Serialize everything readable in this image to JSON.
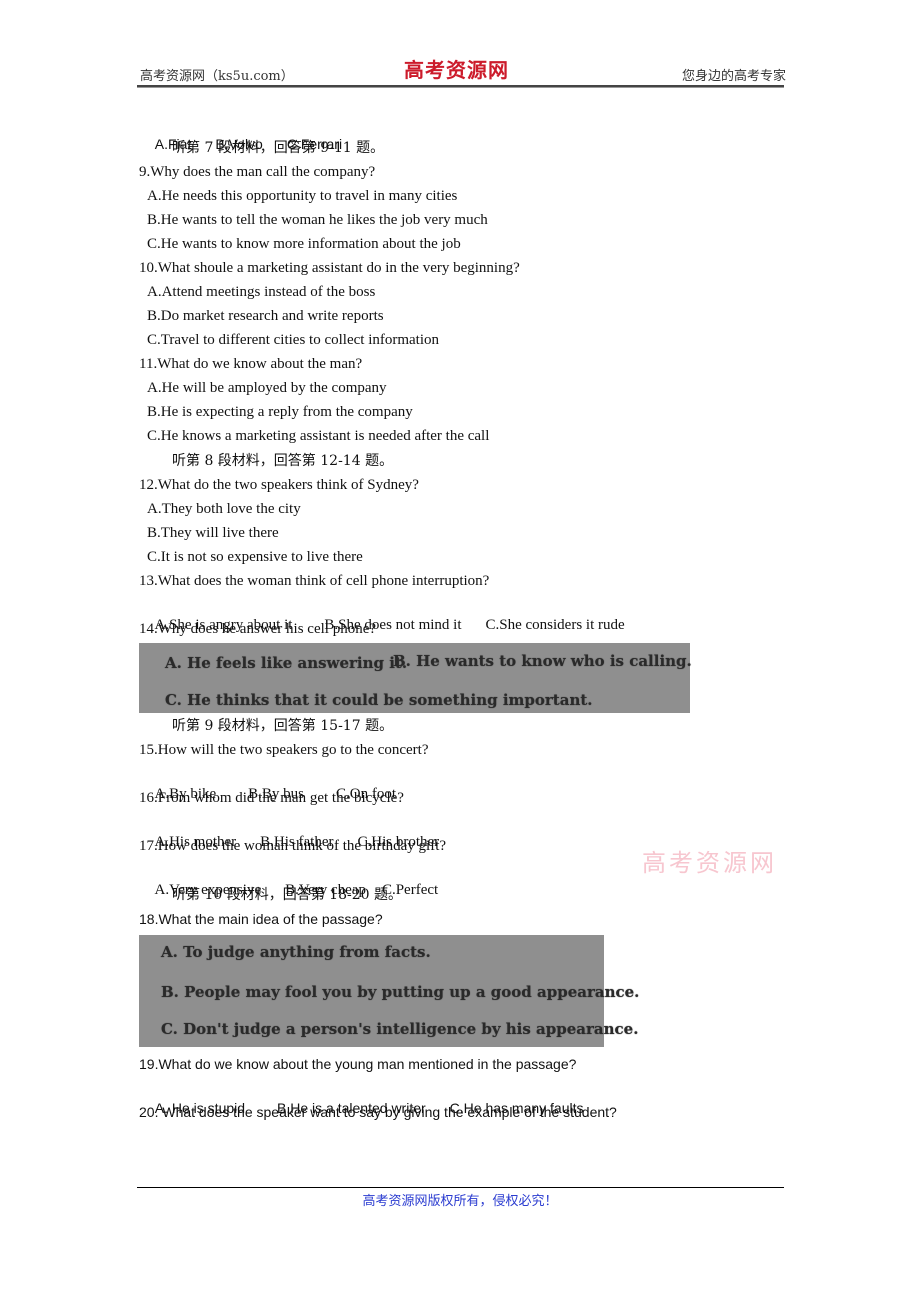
{
  "header": {
    "left": "高考资源网（ks5u.com）",
    "center_logo": "高考资源网",
    "right": "您身边的高考专家"
  },
  "q8_options": [
    "A.Fiat",
    "B.Volvo",
    "C.Ferrari"
  ],
  "section7": "听第 7 段材料，回答第 9-11 题。",
  "q9": {
    "question": "9.Why does the man call the company?",
    "options": [
      "A.He needs this opportunity to travel in many cities",
      "B.He wants to tell the woman he likes the job very much",
      "C.He wants to know more information about the job"
    ]
  },
  "q10": {
    "question": "10.What shoule a marketing assistant do in the very beginning?",
    "options": [
      "A.Attend meetings instead of the boss",
      "B.Do market research and write reports",
      "C.Travel to different cities to collect information"
    ]
  },
  "q11": {
    "question": "11.What do we know about the man?",
    "options": [
      "A.He will be amployed by the company",
      "B.He is expecting a reply from the company",
      "C.He knows a marketing assistant is needed after the call"
    ]
  },
  "section8": "听第 8 段材料，回答第 12-14 题。",
  "q12": {
    "question": "12.What do the two speakers think of Sydney?",
    "options": [
      "A.They both love the city",
      "B.They will live there",
      "C.It is not so expensive to live there"
    ]
  },
  "q13": {
    "question": "13.What does the woman think of cell phone interruption?",
    "options": [
      "A.She is angry about it",
      "B.She does not mind it",
      "C.She considers it rude"
    ]
  },
  "q14": {
    "question": "14.Why does he answer his cell phone?",
    "options": [
      "A. He feels like answering it.",
      "B. He wants to know who is calling.",
      "C. He thinks that it could be something important."
    ]
  },
  "section9": "听第 9 段材料，回答第 15-17 题。",
  "q15": {
    "question": "15.How will the two speakers go to the concert?",
    "options": [
      "A.By bike",
      "B.By bus",
      "C.On foot"
    ]
  },
  "q16": {
    "question": "16.From whom did the man get the bicycle?",
    "options": [
      "A.His mother",
      "B.His father",
      "C.His brother"
    ]
  },
  "q17": {
    "question": "17.How does the woman think of the birthday gift?",
    "options": [
      "A.Very expensive",
      "B.Very cheap",
      "C.Perfect"
    ]
  },
  "watermark": "高考资源网",
  "section10": "听第 10 段材料，回答第 18-20 题。",
  "q18": {
    "question": "18.What the main idea of the passage?",
    "options": [
      "A. To judge anything from facts.",
      "B. People may fool you by putting up a good appearance.",
      "C. Don't judge a person's intelligence by his appearance."
    ]
  },
  "q19": {
    "question": "19.What do we know about the young man mentioned in the passage?",
    "options": [
      "A. He is stupid",
      "B.He is a talented writer",
      "C.He has many faults"
    ]
  },
  "q20": {
    "question": "20. What does the speaker want to say by giving the example of the student?"
  },
  "footer": {
    "text": "高考资源网版权所有，侵权必究！"
  }
}
